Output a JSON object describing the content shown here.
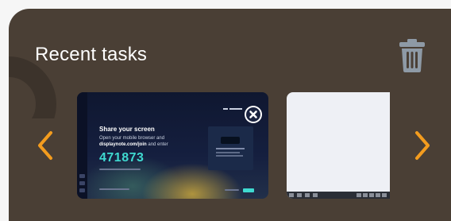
{
  "header": {
    "title": "Recent tasks"
  },
  "icons": {
    "delete": "trash-icon",
    "prev": "chevron-left-icon",
    "next": "chevron-right-icon",
    "close_task": "close-icon"
  },
  "colors": {
    "panel_bg": "#4a3f35",
    "accent_orange": "#f39c1e",
    "code_cyan": "#3fd9d0"
  },
  "tasks": [
    {
      "share": {
        "title": "Share your screen",
        "line1": "Open your mobile browser and",
        "line2_bold": "displaynote.com/join",
        "line2_rest": " and enter",
        "code": "471873"
      }
    },
    {}
  ]
}
